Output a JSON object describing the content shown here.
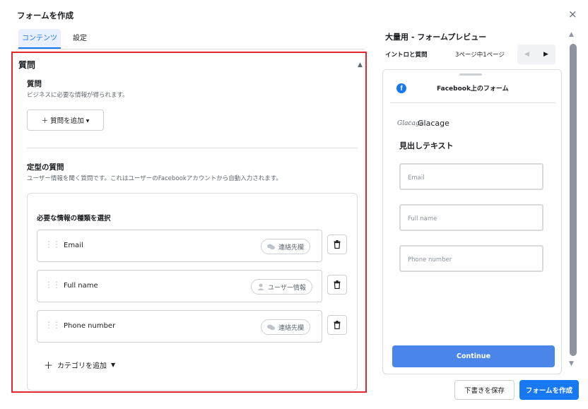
{
  "dialog": {
    "title": "フォームを作成",
    "close_icon": "×"
  },
  "tabs": [
    {
      "label": "コンテンツ",
      "active": true
    },
    {
      "label": "設定",
      "active": false
    }
  ],
  "section": {
    "heading": "質問",
    "questions": {
      "title": "質問",
      "subtitle": "ビジネスに必要な情報が得られます。",
      "add_button": "＋ 質問を追加 ▾"
    },
    "standard": {
      "title": "定型の質問",
      "subtitle": "ユーザー情報を聞く質問です。これはユーザーのFacebookアカウントから自動入力されます。",
      "card_title": "必要な情報の種類を選択",
      "rows": [
        {
          "label": "Email",
          "tag": "連絡先欄",
          "tag_icon": "chat-icon"
        },
        {
          "label": "Full name",
          "tag": "ユーザー情報",
          "tag_icon": "person-icon"
        },
        {
          "label": "Phone number",
          "tag": "連絡先欄",
          "tag_icon": "chat-icon"
        }
      ],
      "add_category": "カテゴリを追加"
    }
  },
  "preview": {
    "title": "大量用 - フォームプレビュー",
    "nav_label": "イントロと質問",
    "page_indicator": "3ページ中1ページ",
    "form_title": "Facebook上のフォーム",
    "brand_logo": "Glacage",
    "brand_name": "Glacage",
    "headline": "見出しテキスト",
    "fields": [
      "Email",
      "Full name",
      "Phone number"
    ],
    "continue_label": "Continue"
  },
  "footer": {
    "save_draft": "下書きを保存",
    "create": "フォームを作成"
  },
  "colors": {
    "accent": "#1877f2",
    "highlight_border": "#e5262d"
  }
}
